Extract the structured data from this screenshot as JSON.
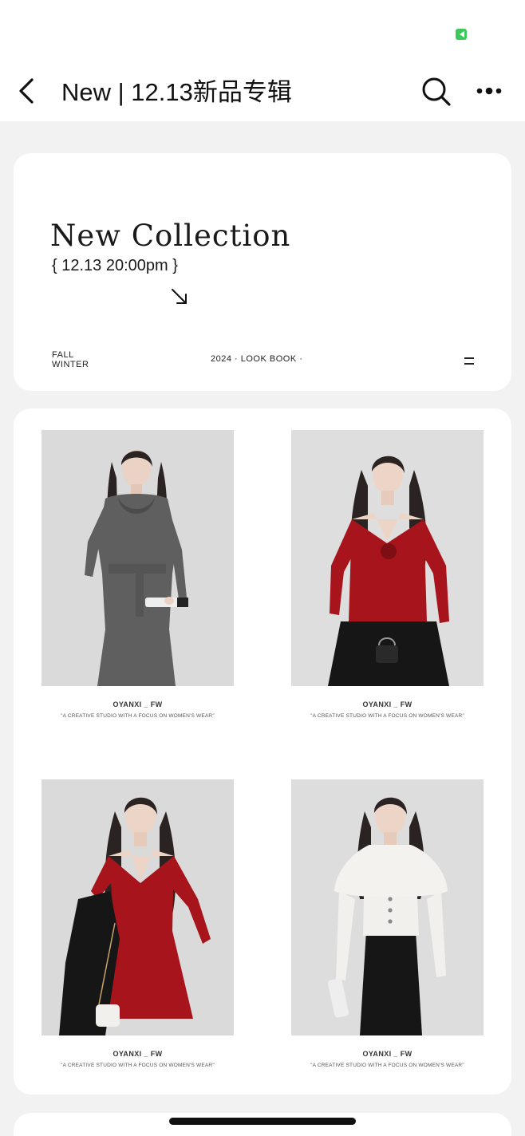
{
  "nav": {
    "title": "New | 12.13新品专辑",
    "back_icon": "chevron-left-icon",
    "search_icon": "search-icon",
    "more_icon": "more-dots-icon"
  },
  "hero": {
    "title": "New Collection",
    "date": "{ 12.13 20:00pm }",
    "arrow_icon": "arrow-down-right-icon",
    "season_line1": "FALL",
    "season_line2": "WINTER",
    "lookbook": "2024 · LOOK BOOK ·",
    "menu_icon": "hamburger-icon"
  },
  "products": [
    {
      "brand": "OYANXI _ FW",
      "tagline": "\"A CREATIVE STUDIO WITH A FOCUS ON WOMEN'S WEAR\"",
      "outfit": "grey cowl-neck maxi dress"
    },
    {
      "brand": "OYANXI _ FW",
      "tagline": "\"A CREATIVE STUDIO WITH A FOCUS ON WOMEN'S WEAR\"",
      "outfit": "red rosette knit top"
    },
    {
      "brand": "OYANXI _ FW",
      "tagline": "\"A CREATIVE STUDIO WITH A FOCUS ON WOMEN'S WEAR\"",
      "outfit": "red v-neck knit dress"
    },
    {
      "brand": "OYANXI _ FW",
      "tagline": "\"A CREATIVE STUDIO WITH A FOCUS ON WOMEN'S WEAR\"",
      "outfit": "white cape cardigan"
    }
  ],
  "colors": {
    "background": "#f2f2f2",
    "card": "#ffffff",
    "status_indicator": "#3cc85a",
    "grey_dress": "#5f5f5f",
    "red_knit": "#a8141c",
    "black": "#161616",
    "cream": "#f2f0ec"
  }
}
